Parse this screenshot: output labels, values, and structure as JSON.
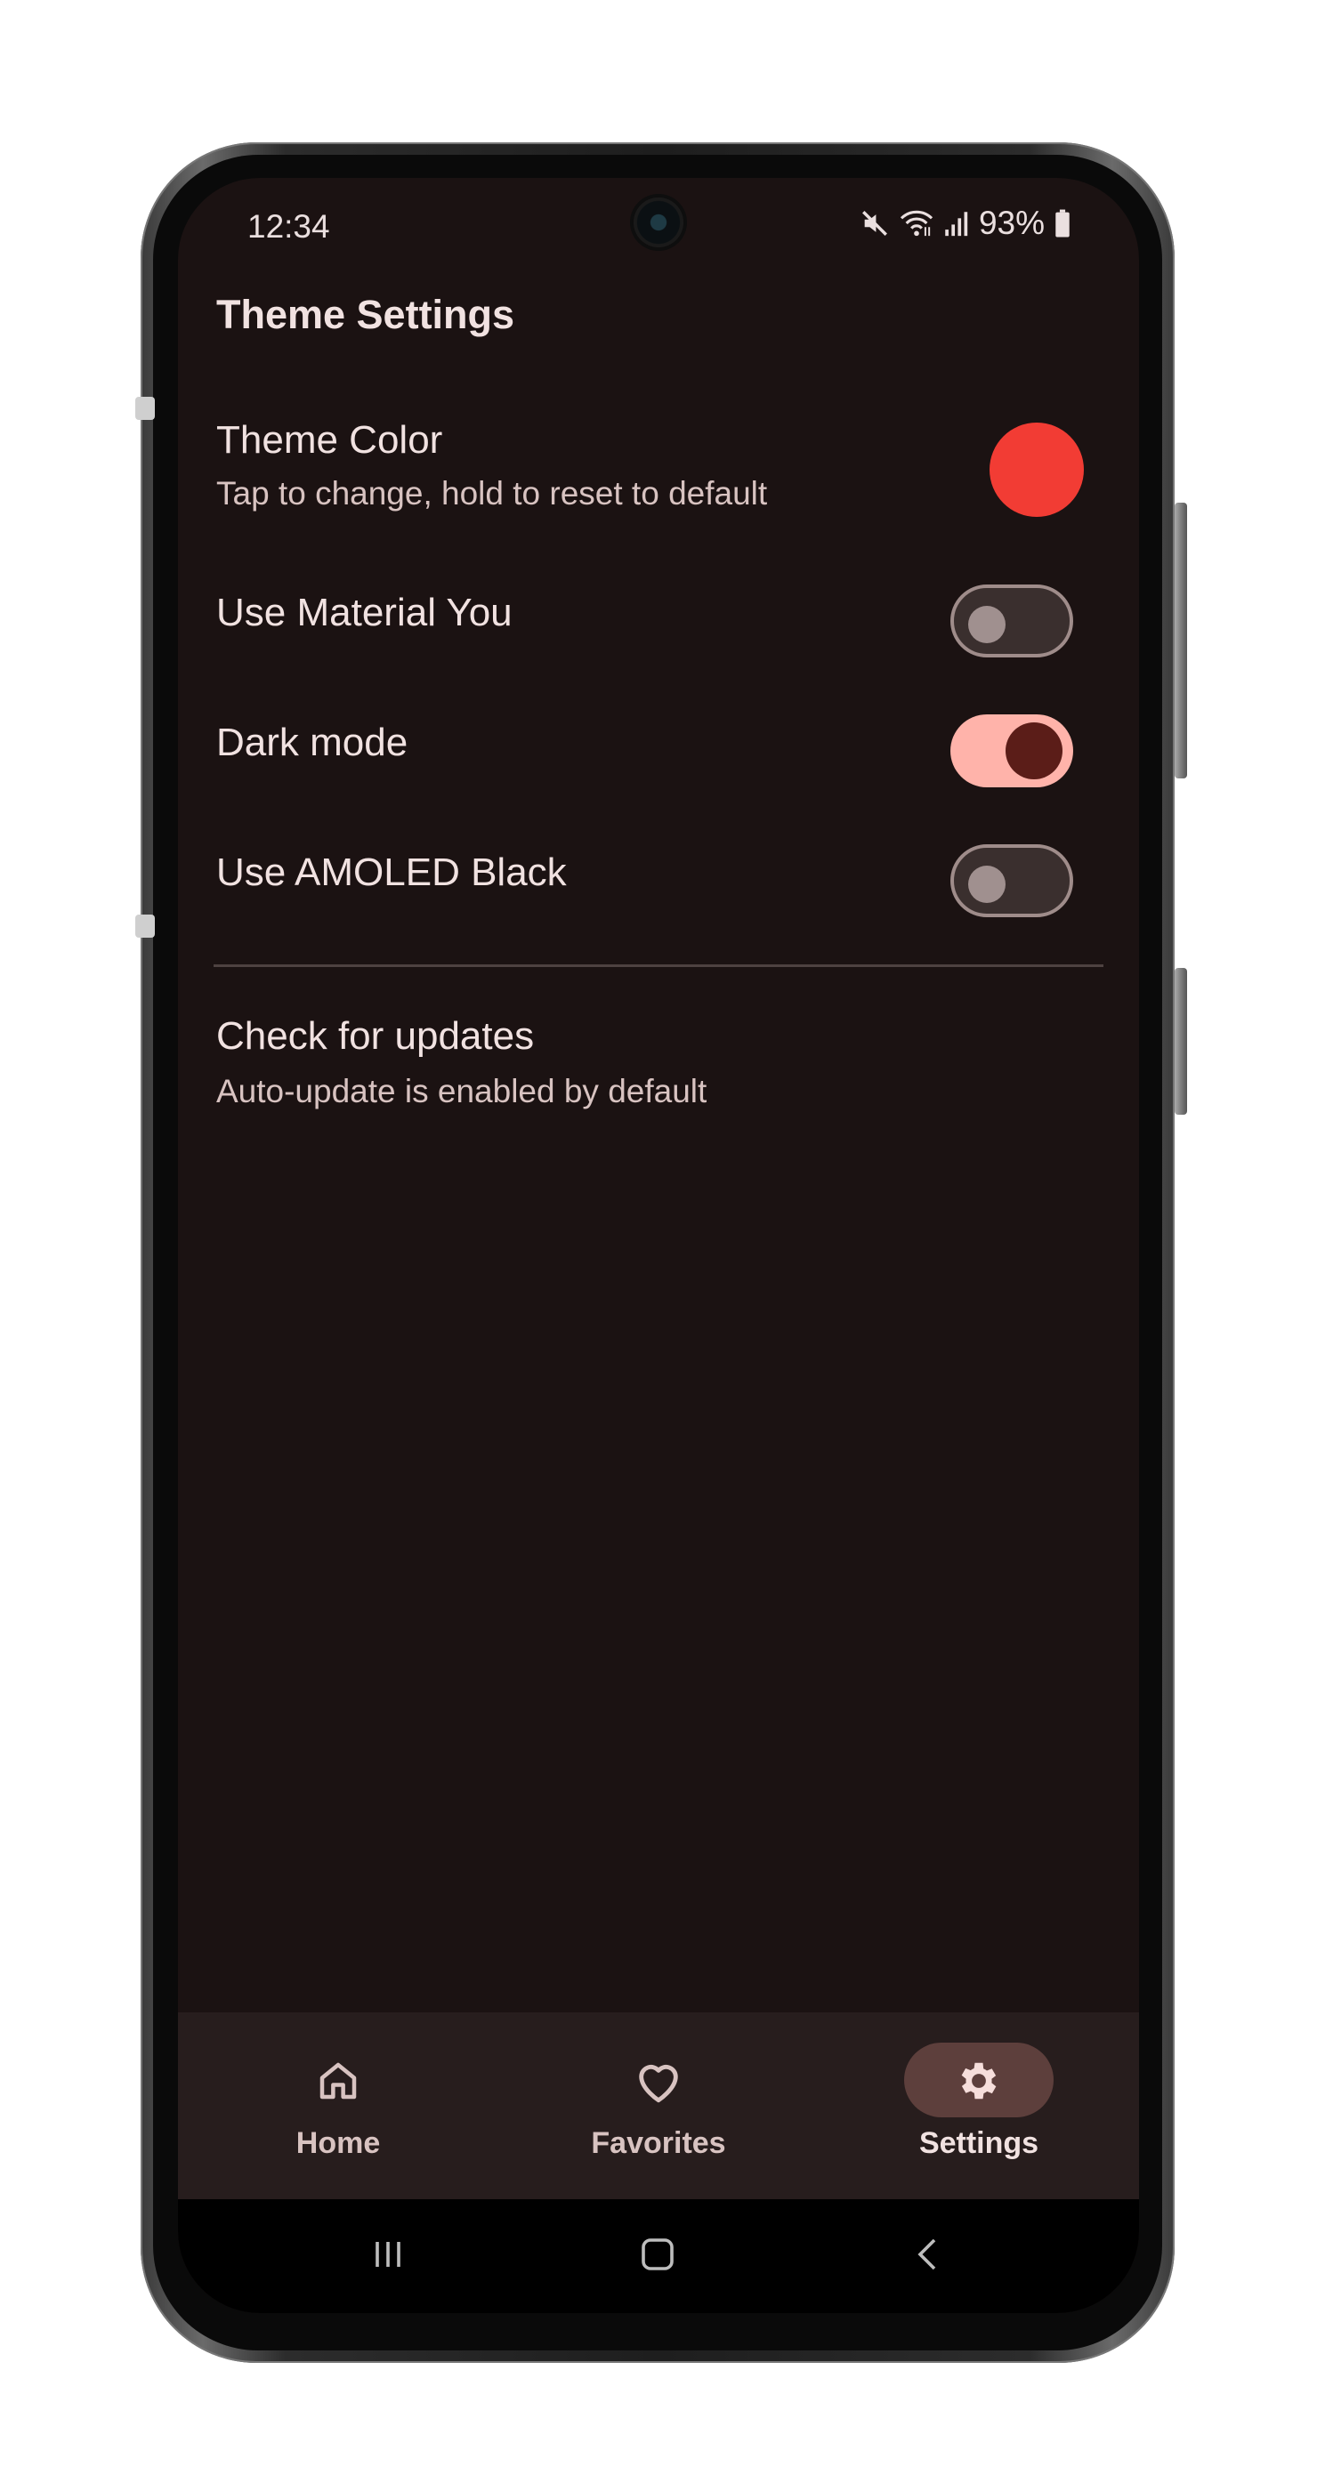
{
  "status_bar": {
    "time": "12:34",
    "battery": "93%"
  },
  "section": {
    "title": "Theme Settings"
  },
  "settings": {
    "theme_color": {
      "title": "Theme Color",
      "subtitle": "Tap to change, hold to reset to default",
      "color": "#f23c34"
    },
    "material_you": {
      "title": "Use Material You",
      "enabled": false
    },
    "dark_mode": {
      "title": "Dark mode",
      "enabled": true
    },
    "amoled_black": {
      "title": "Use AMOLED Black",
      "enabled": false
    },
    "updates": {
      "title": "Check for updates",
      "subtitle": "Auto-update is enabled by default"
    }
  },
  "bottom_nav": {
    "items": [
      {
        "label": "Home",
        "icon": "home-icon",
        "active": false
      },
      {
        "label": "Favorites",
        "icon": "heart-icon",
        "active": false
      },
      {
        "label": "Settings",
        "icon": "gear-icon",
        "active": true
      }
    ]
  },
  "system_nav": {
    "icons": [
      "recents-icon",
      "home-button-icon",
      "back-icon"
    ]
  },
  "colors": {
    "background": "#1b1212",
    "text_primary": "#f1e2e1",
    "switch_on_track": "#ffb3aa",
    "switch_on_knob": "#5b1d18",
    "nav_active_pill": "#5d3f3c"
  }
}
